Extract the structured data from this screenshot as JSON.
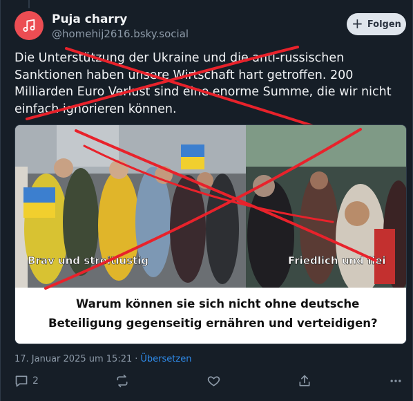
{
  "author": {
    "display_name": "Puja charry",
    "handle": "@homehij2616.bsky.social",
    "avatar_icon": "music-note-icon",
    "avatar_color": "#ec4d53"
  },
  "follow_button": {
    "label": "Folgen",
    "icon": "plus-icon"
  },
  "post": {
    "text": "Die Unterstützung der Ukraine und die anti-russischen Sanktionen haben unsere Wirtschaft hart getroffen. 200 Milliarden Euro Verlust sind eine enorme Summe, die wir nicht einfach ignorieren können."
  },
  "embed_image": {
    "left_caption": "Brav und streitlustig",
    "right_caption": "Friedlich und flei",
    "bottom_line_1": "Warum können sie sich nicht ohne deutsche",
    "bottom_line_2": "Beteiligung gegenseitig ernähren und verteidigen?"
  },
  "meta": {
    "timestamp": "17. Januar 2025 um 15:21",
    "separator": "·",
    "translate_label": "Übersetzen"
  },
  "actions": {
    "reply_count": "2",
    "reply_icon": "reply-icon",
    "repost_icon": "repost-icon",
    "like_icon": "heart-icon",
    "share_icon": "share-icon",
    "more_icon": "more-icon"
  },
  "colors": {
    "background": "#161e27",
    "accent": "#2f8bea",
    "strike": "#e8222b"
  }
}
